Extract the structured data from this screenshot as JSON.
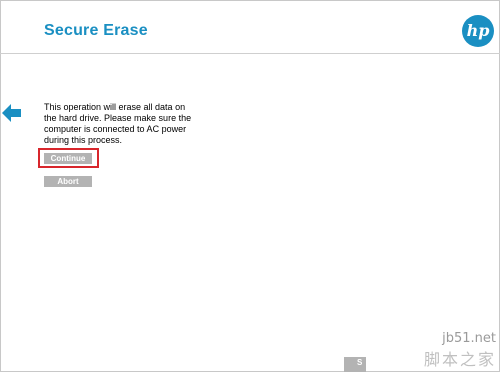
{
  "header": {
    "title": "Secure Erase",
    "logo_text": "hp"
  },
  "nav": {
    "back_icon": "back-arrow-icon"
  },
  "main": {
    "message": "This operation will erase all data on the hard drive. Please make sure the computer is connected to AC power during this process.",
    "continue_label": "Continue",
    "abort_label": "Abort"
  },
  "footer": {
    "partial_button_label": "S"
  },
  "watermark": {
    "url": "jb51.net",
    "name": "脚本之家"
  },
  "colors": {
    "accent": "#1a8fc2",
    "button_gray": "#b3b3b3",
    "highlight_red": "#d8262c"
  }
}
